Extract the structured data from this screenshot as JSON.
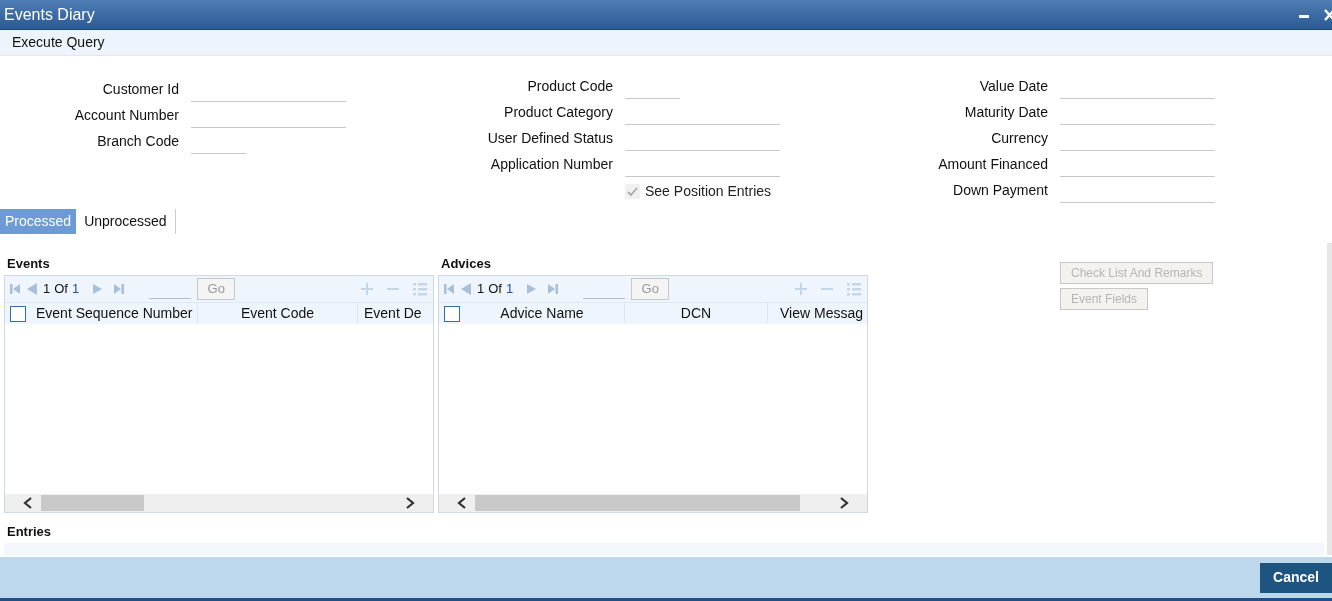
{
  "window": {
    "title": "Events Diary"
  },
  "menu": [
    "Execute Query"
  ],
  "form": {
    "columns": [
      {
        "fields": [
          {
            "label": "Customer Id",
            "kind": "wide"
          },
          {
            "label": "Account Number",
            "kind": "wide"
          },
          {
            "label": "Branch Code",
            "kind": "short"
          }
        ]
      },
      {
        "fields": [
          {
            "label": "Product Code",
            "kind": "short"
          },
          {
            "label": "Product Category",
            "kind": "wide"
          },
          {
            "label": "User Defined Status",
            "kind": "wide"
          },
          {
            "label": "Application Number",
            "kind": "wide"
          },
          {
            "label": "See Position Entries",
            "kind": "checkbox",
            "checked": true,
            "disabled": true
          }
        ]
      },
      {
        "fields": [
          {
            "label": "Value Date",
            "kind": "wide"
          },
          {
            "label": "Maturity Date",
            "kind": "wide"
          },
          {
            "label": "Currency",
            "kind": "wide"
          },
          {
            "label": "Amount Financed",
            "kind": "wide"
          },
          {
            "label": "Down Payment",
            "kind": "wide"
          }
        ]
      }
    ]
  },
  "tabs": [
    {
      "label": "Processed",
      "selected": true
    },
    {
      "label": "Unprocessed",
      "selected": false
    }
  ],
  "grids": [
    {
      "title": "Events",
      "pager": {
        "current": "1",
        "of": "Of",
        "total": "1"
      },
      "go": "Go",
      "select_all": false,
      "columns": [
        "Event Sequence Number",
        "Event Code",
        "Event De"
      ]
    },
    {
      "title": "Advices",
      "pager": {
        "current": "1",
        "of": "Of",
        "total": "1"
      },
      "go": "Go",
      "select_all": false,
      "columns": [
        "Advice Name",
        "DCN",
        "View Messag"
      ]
    }
  ],
  "side_buttons": [
    {
      "label": "Check List And Remarks",
      "disabled": true
    },
    {
      "label": "Event Fields",
      "disabled": true
    }
  ],
  "entries": {
    "title": "Entries"
  },
  "footer": {
    "buttons": [
      "Cancel"
    ]
  }
}
